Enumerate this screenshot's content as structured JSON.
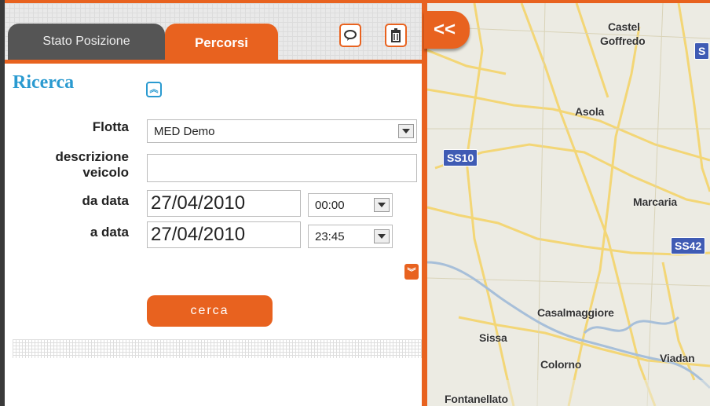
{
  "tabs": {
    "stato_posizione": "Stato Posizione",
    "percorsi": "Percorsi"
  },
  "toolbar": {
    "comment_icon": "speech-bubble-icon",
    "delete_icon": "trash-icon",
    "collapse_panel": "<<"
  },
  "search": {
    "title": "Ricerca",
    "collapse_glyph": "⌃",
    "expand_glyph": "⌄",
    "fields": {
      "flotta_label": "Flotta",
      "flotta_value": "MED Demo",
      "descrizione_label_line1": "descrizione",
      "descrizione_label_line2": "veicolo",
      "descrizione_value": "",
      "da_data_label": "da data",
      "da_data_value": "27/04/2010",
      "da_time_value": "00:00",
      "a_data_label": "a data",
      "a_data_value": "27/04/2010",
      "a_time_value": "23:45"
    },
    "submit_label": "cerca"
  },
  "map": {
    "places": [
      "Castel",
      "Goffredo",
      "Asola",
      "Marcaria",
      "Casalmaggiore",
      "Sissa",
      "Colorno",
      "Viadan",
      "Fontanellato"
    ],
    "roads": [
      "SS10",
      "SS42",
      "S"
    ],
    "colors": {
      "road": "#f3d676",
      "water": "#a7bfd9",
      "shield": "#3f5bb4",
      "background": "#ecebe3"
    }
  },
  "colors": {
    "accent": "#e8621f",
    "title": "#2a9ad0",
    "tab_inactive": "#555555"
  }
}
